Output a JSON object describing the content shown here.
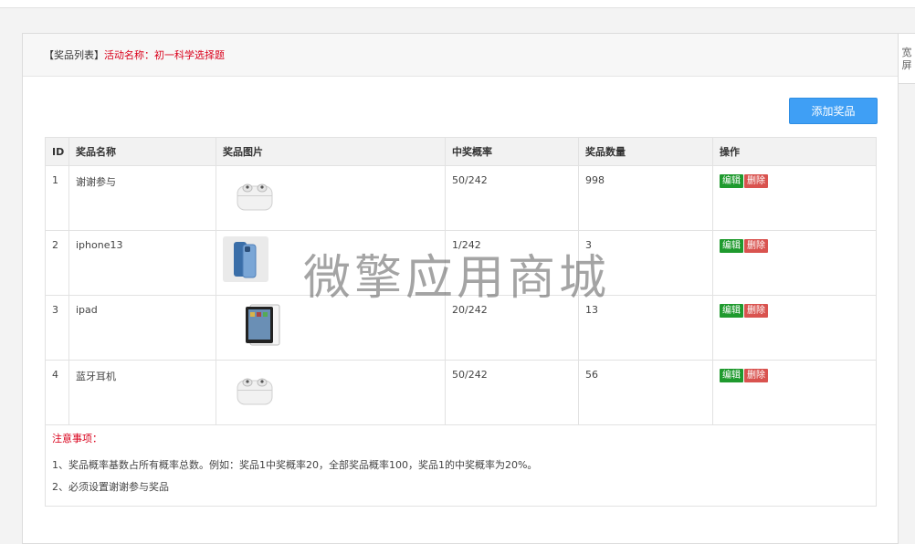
{
  "header": {
    "title": "【奖品列表】",
    "activity": "活动名称：初一科学选择题"
  },
  "toolbar": {
    "add_label": "添加奖品"
  },
  "side_tab": {
    "label": "宽屏"
  },
  "table": {
    "columns": [
      "ID",
      "奖品名称",
      "奖品图片",
      "中奖概率",
      "奖品数量",
      "操作"
    ],
    "rows": [
      {
        "id": "1",
        "name": "谢谢参与",
        "image": "airpods-image",
        "probability": "50/242",
        "quantity": "998"
      },
      {
        "id": "2",
        "name": "iphone13",
        "image": "iphone-image",
        "probability": "1/242",
        "quantity": "3"
      },
      {
        "id": "3",
        "name": "ipad",
        "image": "ipad-image",
        "probability": "20/242",
        "quantity": "13"
      },
      {
        "id": "4",
        "name": "蓝牙耳机",
        "image": "airpods-image",
        "probability": "50/242",
        "quantity": "56"
      }
    ],
    "edit_label": "编辑",
    "delete_label": "删除"
  },
  "notes": {
    "title": "注意事项：",
    "lines": [
      "1、奖品概率基数占所有概率总数。例如：奖品1中奖概率20，全部奖品概率100，奖品1的中奖概率为20%。",
      "2、必须设置谢谢参与奖品"
    ]
  },
  "watermark": "微擎应用商城",
  "colors": {
    "accent": "#3f9ff5",
    "edit": "#1f9a2e",
    "delete": "#d9534f",
    "alert": "#d9001b"
  }
}
